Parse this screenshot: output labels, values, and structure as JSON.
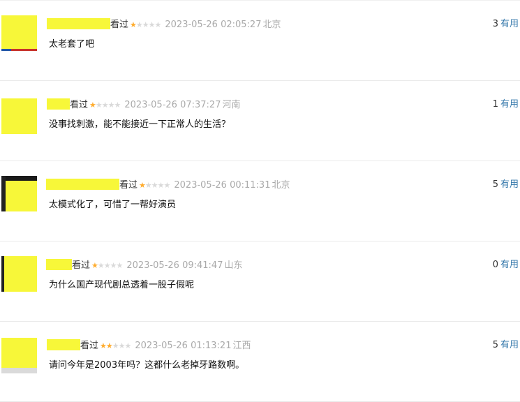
{
  "reviews": [
    {
      "status": "看过",
      "stars": 1,
      "time": "2023-05-26 02:05:27",
      "location": "北京",
      "votes": "3",
      "useful_label": "有用",
      "comment": "太老套了吧"
    },
    {
      "status": "看过",
      "stars": 1,
      "time": "2023-05-26 07:37:27",
      "location": "河南",
      "votes": "1",
      "useful_label": "有用",
      "comment": "没事找刺激，能不能接近一下正常人的生活？"
    },
    {
      "status": "看过",
      "stars": 1,
      "time": "2023-05-26 00:11:31",
      "location": "北京",
      "votes": "5",
      "useful_label": "有用",
      "comment": "太模式化了，可惜了一帮好演员"
    },
    {
      "status": "看过",
      "stars": 1,
      "time": "2023-05-26 09:41:47",
      "location": "山东",
      "votes": "0",
      "useful_label": "有用",
      "comment": "为什么国产现代剧总透着一股子假呢"
    },
    {
      "status": "看过",
      "stars": 2,
      "time": "2023-05-26 01:13:21",
      "location": "江西",
      "votes": "5",
      "useful_label": "有用",
      "comment": "请问今年是2003年吗？这都什么老掉牙路数啊。"
    }
  ],
  "icons": {
    "star": "star-icon"
  },
  "colors": {
    "redaction": "#f7f739",
    "star_on": "#ffac2d",
    "star_off": "#d9d9d9",
    "link": "#3377aa",
    "meta_grey": "#aaaaaa"
  }
}
